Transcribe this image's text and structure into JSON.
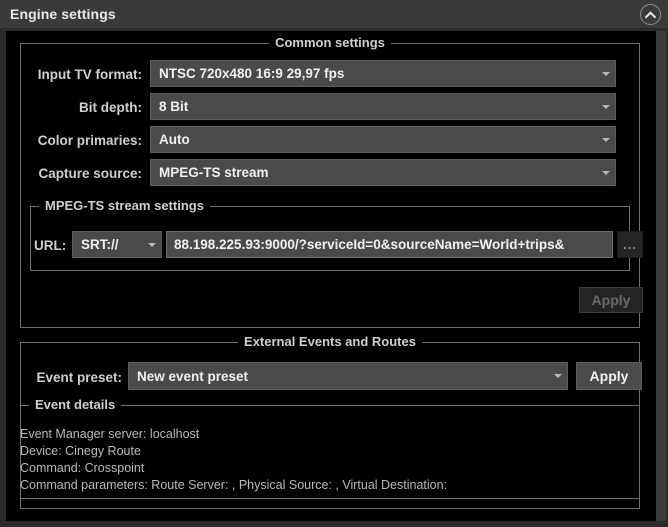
{
  "window": {
    "title": "Engine settings",
    "collapse_icon": "chevron-up-circle-icon"
  },
  "common_settings": {
    "group_title": "Common settings",
    "rows": [
      {
        "label": "Input TV format:",
        "value": "NTSC 720x480 16:9 29,97 fps",
        "arrow_icon": "chevron-down-icon"
      },
      {
        "label": "Bit depth:",
        "value": "8 Bit",
        "arrow_icon": "chevron-down-icon"
      },
      {
        "label": "Color primaries:",
        "value": "Auto",
        "arrow_icon": "chevron-down-icon"
      },
      {
        "label": "Capture source:",
        "value": "MPEG-TS stream",
        "arrow_icon": "chevron-down-icon"
      }
    ],
    "mpeg_ts": {
      "group_title": "MPEG-TS stream settings",
      "url_label": "URL:",
      "protocol": "SRT://",
      "protocol_arrow_icon": "chevron-down-icon",
      "url_value": "88.198.225.93:9000/?serviceId=0&sourceName=World+trips&",
      "browse_label": "...",
      "browse_icon": "ellipsis-icon"
    },
    "apply_label": "Apply",
    "apply_disabled": true
  },
  "external_events": {
    "group_title": "External Events and Routes",
    "preset_label": "Event preset:",
    "preset_value": "New event preset",
    "preset_arrow_icon": "chevron-down-icon",
    "apply_label": "Apply",
    "details": {
      "group_title": "Event details",
      "lines": [
        "Event Manager server: localhost",
        "Device: Cinegy Route",
        "Command: Crosspoint",
        "Command parameters: Route Server: , Physical Source: , Virtual Destination:"
      ]
    }
  },
  "colors": {
    "titlebar_bg": "#3a3a3a",
    "panel_bg": "#2b2b2b",
    "content_bg": "#000000",
    "control_bg": "#4a4a4a",
    "border": "#707070",
    "text": "#cfcfcf"
  }
}
